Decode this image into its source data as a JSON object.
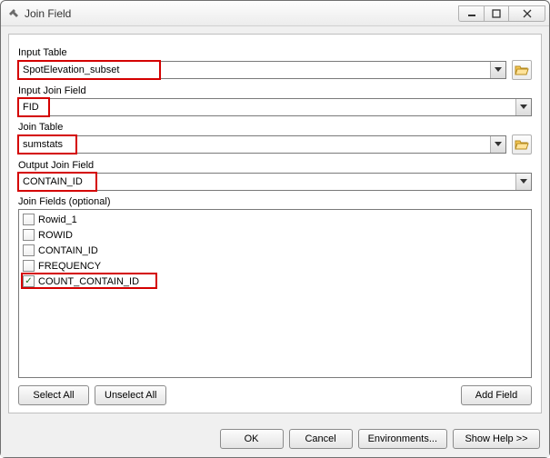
{
  "window": {
    "title": "Join Field"
  },
  "labels": {
    "input_table": "Input Table",
    "input_join_field": "Input Join Field",
    "join_table": "Join Table",
    "output_join_field": "Output Join Field",
    "join_fields_optional": "Join Fields (optional)"
  },
  "values": {
    "input_table": "SpotElevation_subset",
    "input_join_field": "FID",
    "join_table": "sumstats",
    "output_join_field": "CONTAIN_ID"
  },
  "join_fields": [
    {
      "label": "Rowid_1",
      "checked": false
    },
    {
      "label": "ROWID",
      "checked": false
    },
    {
      "label": "CONTAIN_ID",
      "checked": false
    },
    {
      "label": "FREQUENCY",
      "checked": false
    },
    {
      "label": "COUNT_CONTAIN_ID",
      "checked": true
    }
  ],
  "buttons": {
    "select_all": "Select All",
    "unselect_all": "Unselect All",
    "add_field": "Add Field",
    "ok": "OK",
    "cancel": "Cancel",
    "environments": "Environments...",
    "show_help": "Show Help >>"
  }
}
